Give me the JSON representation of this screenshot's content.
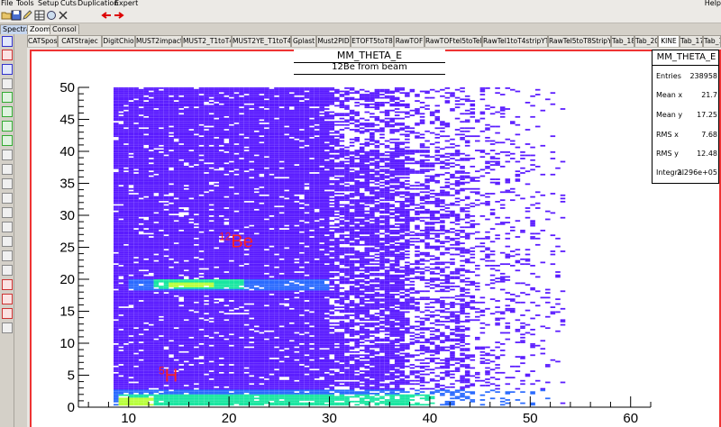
{
  "menubar": {
    "items": [
      "File",
      "Tools",
      "Setup",
      "Cuts",
      "Duplication",
      "Expert"
    ],
    "help": "Help"
  },
  "toolbar": {
    "buttons": [
      "open-folder-icon",
      "save-icon",
      "edit-icon",
      "zoom-icon",
      "cut-icon",
      "arrow-left-icon",
      "arrow-right-icon"
    ]
  },
  "mode_tabs": [
    "Spectra",
    "Zoom",
    "Consol"
  ],
  "canvas_tabs": [
    "CATSpos",
    "CATStrajec",
    "DigitChio",
    "MUST2impact",
    "MUST2_T1toT4",
    "MUST2YE_T1toT4",
    "Gplast",
    "Must2PID",
    "ETOFT5toT8",
    "RawTOF",
    "RawTOFtel5toTel8",
    "RawTel1toT4stripYT",
    "RawTel5toT8StripYT",
    "Tab_18",
    "Tab_20",
    "KINE",
    "Tab_17",
    "Tab_18"
  ],
  "active_canvas_tab": "KINE",
  "histogram": {
    "title": "MM_THETA_E",
    "subtitle": "12Be from beam",
    "label_be_sup": "12",
    "label_be": "Be",
    "label_h_sup": "5",
    "label_h": "H"
  },
  "stats": {
    "title": "MM_THETA_E",
    "rows": [
      {
        "label": "Entries",
        "value": "238958"
      },
      {
        "label": "Mean x",
        "value": "21.7"
      },
      {
        "label": "Mean y",
        "value": "17.25"
      },
      {
        "label": "RMS x",
        "value": "7.68"
      },
      {
        "label": "RMS y",
        "value": "12.48"
      },
      {
        "label": "Integral",
        "value": "2.296e+05"
      }
    ]
  },
  "chart_data": {
    "type": "heatmap",
    "title": "MM_THETA_E",
    "subtitle": "12Be from beam",
    "xlim": [
      5,
      62
    ],
    "ylim": [
      0,
      50
    ],
    "x_ticks": [
      10,
      20,
      30,
      40,
      50,
      60
    ],
    "y_ticks": [
      0,
      5,
      10,
      15,
      20,
      25,
      30,
      35,
      40,
      45,
      50
    ],
    "colors": {
      "background_bins": "#5a1bff",
      "medium": "#2b6bff",
      "hot": "#19e6a0",
      "peak": "#b8ff3a"
    },
    "regions": [
      {
        "name": "12Be band",
        "x": [
          12,
          30
        ],
        "y": [
          18,
          20.5
        ]
      },
      {
        "name": "5H band",
        "x": [
          8.5,
          38
        ],
        "y": [
          0.5,
          2.5
        ]
      }
    ],
    "annotations": [
      {
        "text": "12Be",
        "x": 19,
        "y": 25
      },
      {
        "text": "5H",
        "x": 13,
        "y": 4
      }
    ]
  }
}
